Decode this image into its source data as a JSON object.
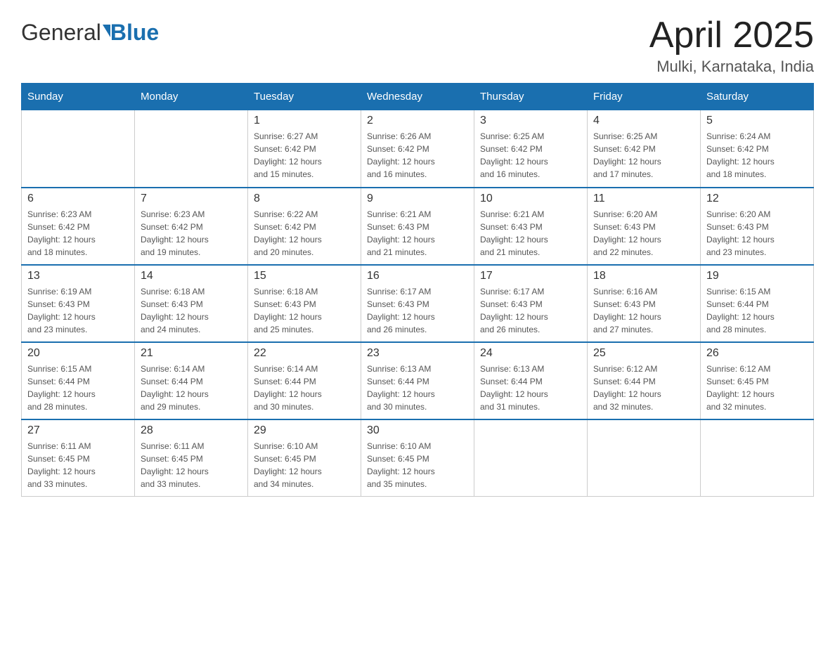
{
  "header": {
    "logo_text_general": "General",
    "logo_text_blue": "Blue",
    "month_title": "April 2025",
    "location": "Mulki, Karnataka, India"
  },
  "weekdays": [
    "Sunday",
    "Monday",
    "Tuesday",
    "Wednesday",
    "Thursday",
    "Friday",
    "Saturday"
  ],
  "weeks": [
    [
      {
        "day": "",
        "info": ""
      },
      {
        "day": "",
        "info": ""
      },
      {
        "day": "1",
        "info": "Sunrise: 6:27 AM\nSunset: 6:42 PM\nDaylight: 12 hours\nand 15 minutes."
      },
      {
        "day": "2",
        "info": "Sunrise: 6:26 AM\nSunset: 6:42 PM\nDaylight: 12 hours\nand 16 minutes."
      },
      {
        "day": "3",
        "info": "Sunrise: 6:25 AM\nSunset: 6:42 PM\nDaylight: 12 hours\nand 16 minutes."
      },
      {
        "day": "4",
        "info": "Sunrise: 6:25 AM\nSunset: 6:42 PM\nDaylight: 12 hours\nand 17 minutes."
      },
      {
        "day": "5",
        "info": "Sunrise: 6:24 AM\nSunset: 6:42 PM\nDaylight: 12 hours\nand 18 minutes."
      }
    ],
    [
      {
        "day": "6",
        "info": "Sunrise: 6:23 AM\nSunset: 6:42 PM\nDaylight: 12 hours\nand 18 minutes."
      },
      {
        "day": "7",
        "info": "Sunrise: 6:23 AM\nSunset: 6:42 PM\nDaylight: 12 hours\nand 19 minutes."
      },
      {
        "day": "8",
        "info": "Sunrise: 6:22 AM\nSunset: 6:42 PM\nDaylight: 12 hours\nand 20 minutes."
      },
      {
        "day": "9",
        "info": "Sunrise: 6:21 AM\nSunset: 6:43 PM\nDaylight: 12 hours\nand 21 minutes."
      },
      {
        "day": "10",
        "info": "Sunrise: 6:21 AM\nSunset: 6:43 PM\nDaylight: 12 hours\nand 21 minutes."
      },
      {
        "day": "11",
        "info": "Sunrise: 6:20 AM\nSunset: 6:43 PM\nDaylight: 12 hours\nand 22 minutes."
      },
      {
        "day": "12",
        "info": "Sunrise: 6:20 AM\nSunset: 6:43 PM\nDaylight: 12 hours\nand 23 minutes."
      }
    ],
    [
      {
        "day": "13",
        "info": "Sunrise: 6:19 AM\nSunset: 6:43 PM\nDaylight: 12 hours\nand 23 minutes."
      },
      {
        "day": "14",
        "info": "Sunrise: 6:18 AM\nSunset: 6:43 PM\nDaylight: 12 hours\nand 24 minutes."
      },
      {
        "day": "15",
        "info": "Sunrise: 6:18 AM\nSunset: 6:43 PM\nDaylight: 12 hours\nand 25 minutes."
      },
      {
        "day": "16",
        "info": "Sunrise: 6:17 AM\nSunset: 6:43 PM\nDaylight: 12 hours\nand 26 minutes."
      },
      {
        "day": "17",
        "info": "Sunrise: 6:17 AM\nSunset: 6:43 PM\nDaylight: 12 hours\nand 26 minutes."
      },
      {
        "day": "18",
        "info": "Sunrise: 6:16 AM\nSunset: 6:43 PM\nDaylight: 12 hours\nand 27 minutes."
      },
      {
        "day": "19",
        "info": "Sunrise: 6:15 AM\nSunset: 6:44 PM\nDaylight: 12 hours\nand 28 minutes."
      }
    ],
    [
      {
        "day": "20",
        "info": "Sunrise: 6:15 AM\nSunset: 6:44 PM\nDaylight: 12 hours\nand 28 minutes."
      },
      {
        "day": "21",
        "info": "Sunrise: 6:14 AM\nSunset: 6:44 PM\nDaylight: 12 hours\nand 29 minutes."
      },
      {
        "day": "22",
        "info": "Sunrise: 6:14 AM\nSunset: 6:44 PM\nDaylight: 12 hours\nand 30 minutes."
      },
      {
        "day": "23",
        "info": "Sunrise: 6:13 AM\nSunset: 6:44 PM\nDaylight: 12 hours\nand 30 minutes."
      },
      {
        "day": "24",
        "info": "Sunrise: 6:13 AM\nSunset: 6:44 PM\nDaylight: 12 hours\nand 31 minutes."
      },
      {
        "day": "25",
        "info": "Sunrise: 6:12 AM\nSunset: 6:44 PM\nDaylight: 12 hours\nand 32 minutes."
      },
      {
        "day": "26",
        "info": "Sunrise: 6:12 AM\nSunset: 6:45 PM\nDaylight: 12 hours\nand 32 minutes."
      }
    ],
    [
      {
        "day": "27",
        "info": "Sunrise: 6:11 AM\nSunset: 6:45 PM\nDaylight: 12 hours\nand 33 minutes."
      },
      {
        "day": "28",
        "info": "Sunrise: 6:11 AM\nSunset: 6:45 PM\nDaylight: 12 hours\nand 33 minutes."
      },
      {
        "day": "29",
        "info": "Sunrise: 6:10 AM\nSunset: 6:45 PM\nDaylight: 12 hours\nand 34 minutes."
      },
      {
        "day": "30",
        "info": "Sunrise: 6:10 AM\nSunset: 6:45 PM\nDaylight: 12 hours\nand 35 minutes."
      },
      {
        "day": "",
        "info": ""
      },
      {
        "day": "",
        "info": ""
      },
      {
        "day": "",
        "info": ""
      }
    ]
  ]
}
